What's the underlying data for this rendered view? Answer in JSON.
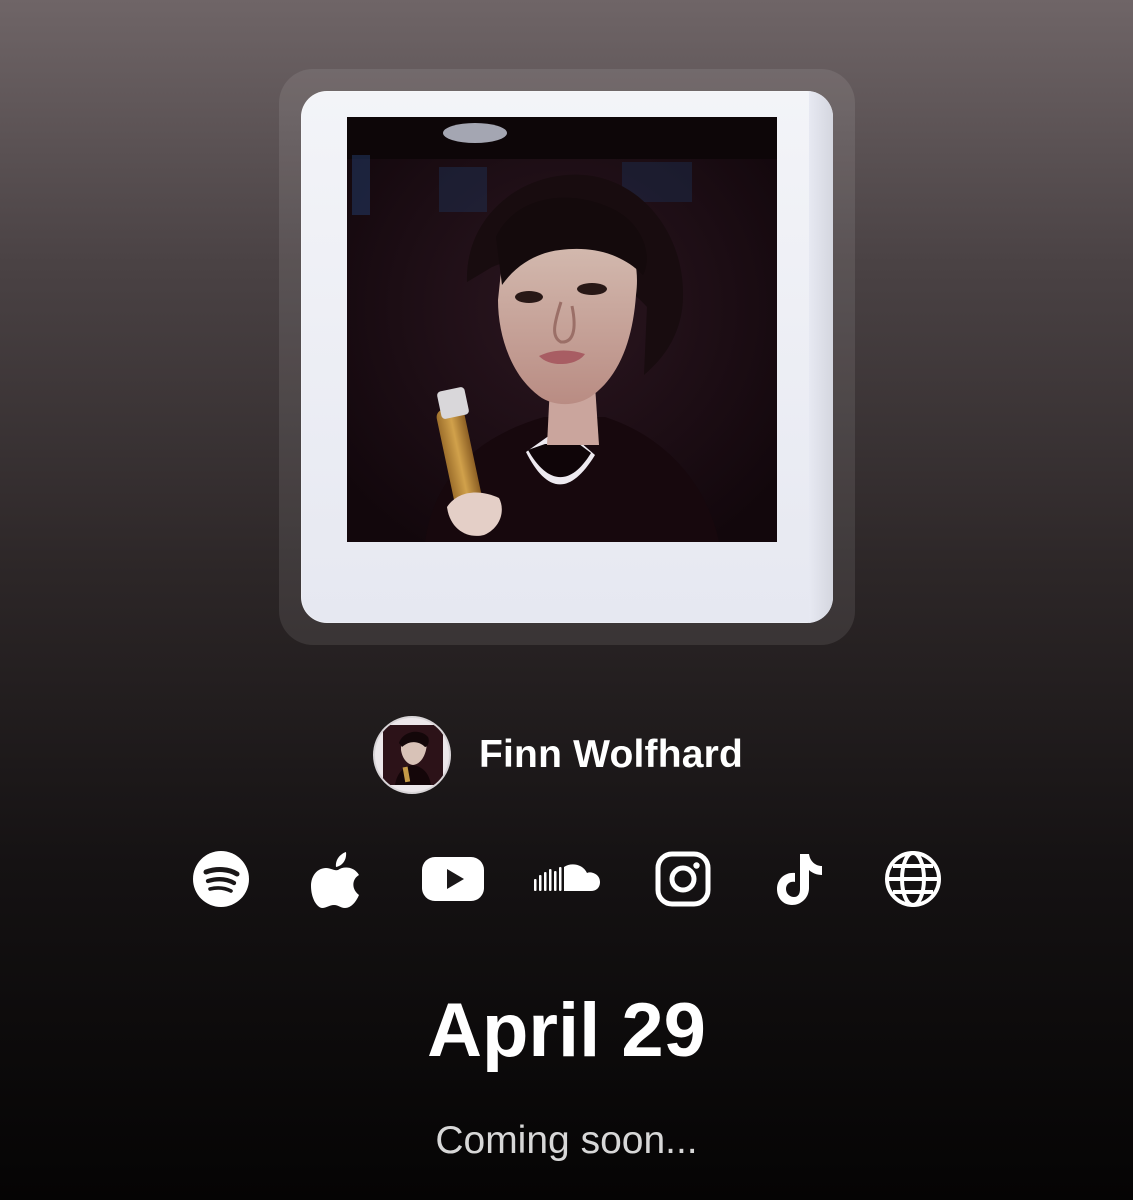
{
  "artwork": {
    "icon": "polaroid-portrait-photo"
  },
  "profile": {
    "avatar_icon": "artist-avatar",
    "name": "Finn Wolfhard"
  },
  "socials": [
    {
      "platform": "Spotify",
      "icon": "spotify-icon"
    },
    {
      "platform": "Apple Music",
      "icon": "apple-icon"
    },
    {
      "platform": "YouTube",
      "icon": "youtube-icon"
    },
    {
      "platform": "SoundCloud",
      "icon": "soundcloud-icon"
    },
    {
      "platform": "Instagram",
      "icon": "instagram-icon"
    },
    {
      "platform": "TikTok",
      "icon": "tiktok-icon"
    },
    {
      "platform": "Website",
      "icon": "globe-icon"
    }
  ],
  "release": {
    "date": "April 29",
    "status": "Coming soon..."
  },
  "colors": {
    "background_top": "#6f6567",
    "background_bottom": "#050404",
    "text": "#ffffff",
    "status_text": "#d7d7d7",
    "polaroid_border": "#eef0f6"
  }
}
